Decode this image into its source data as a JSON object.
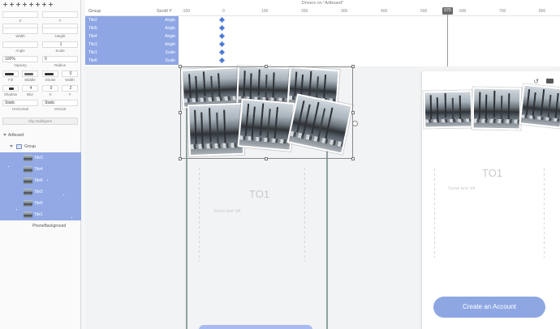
{
  "inspector": {
    "labels": {
      "x": "X",
      "y": "Y",
      "width": "Width",
      "height": "Height",
      "angle": "Angle",
      "scale": "Scale",
      "opacity": "Opacity",
      "radius": "Radius",
      "fill": "Fill",
      "middle": "Middle",
      "stroke": "Stroke",
      "width2": "Width",
      "shadow": "Shadow",
      "blur": "Blur",
      "sx": "X",
      "sy": "Y",
      "horizontal": "Horizontal",
      "vertical": "Vertical"
    },
    "values": {
      "scale": "1",
      "opacity": "100%",
      "radius": "0",
      "stroke_width": "0",
      "blur": "4",
      "shadow_x": "0",
      "shadow_y": "2"
    },
    "selects": {
      "horizontal": "Static",
      "vertical": "Static"
    },
    "clip_button": "Clip Sublayers"
  },
  "layers": {
    "artboard": "Artboard",
    "group": "Group",
    "items": [
      "Tile3",
      "Tile4",
      "Tile6",
      "Tile2",
      "Tile5",
      "Tile1"
    ],
    "background": "PhoneBackground"
  },
  "timeline": {
    "title": "Drivers on \"Artboard\"",
    "col_group": "Group",
    "col_scroll": "Scroll Y",
    "ticks": [
      "-100",
      "0",
      "100",
      "200",
      "300",
      "400",
      "500",
      "600",
      "700",
      "800"
    ],
    "playhead_value": "570",
    "rows": [
      {
        "name": "Tile2",
        "prop": "Angle"
      },
      {
        "name": "Tile5",
        "prop": "Angle"
      },
      {
        "name": "Tile4",
        "prop": "Angle"
      },
      {
        "name": "Tile3",
        "prop": "Angle"
      },
      {
        "name": "Tile1",
        "prop": "Scale"
      },
      {
        "name": "Tile6",
        "prop": "Scale"
      }
    ]
  },
  "canvas": {
    "artboard_heading": "TO1",
    "artboard_subtext": "Some text 'd4"
  },
  "phone": {
    "heading": "TO1",
    "subtext": "Some text 'd4",
    "cta": "Create an Account"
  },
  "colors": {
    "selection": "#92a9e6",
    "accent": "#8ea7e3",
    "keyframe": "#4f7cd3"
  }
}
